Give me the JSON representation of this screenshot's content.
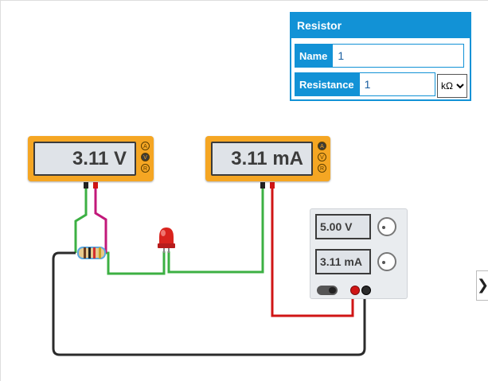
{
  "voltmeter": {
    "reading": "3.11 V",
    "modes": [
      "A",
      "V",
      "R"
    ],
    "active_mode": "V"
  },
  "ammeter": {
    "reading": "3.11 mA",
    "modes": [
      "A",
      "V",
      "R"
    ],
    "active_mode": "A"
  },
  "power_supply": {
    "voltage": "5.00 V",
    "current": "3.11 mA",
    "power_label": "ON"
  },
  "properties_panel": {
    "title": "Resistor",
    "name_label": "Name",
    "name_value": "1",
    "resistance_label": "Resistance",
    "resistance_value": "1",
    "unit_selected": "kΩ"
  },
  "side_toggle_glyph": "❯",
  "colors": {
    "accent": "#1292d6",
    "meter_orange": "#f5a623",
    "wire_green": "#3cb043",
    "wire_magenta": "#c2187a",
    "wire_red": "#d01515",
    "wire_black": "#2b2b2b"
  }
}
